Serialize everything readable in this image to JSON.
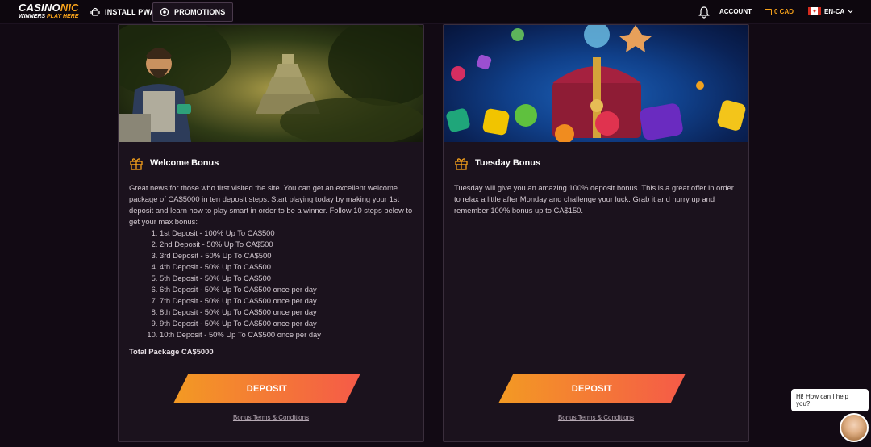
{
  "header": {
    "logo_main": "CASINO",
    "logo_accent": "NIC",
    "logo_tag_1": "WINNERS",
    "logo_tag_2": "PLAY HERE",
    "install_pwa": "INSTALL PWA",
    "promotions": "PROMOTIONS",
    "account": "ACCOUNT",
    "balance": "0 CAD",
    "language": "EN-CA"
  },
  "cards": [
    {
      "title": "Welcome Bonus",
      "intro": "Great news for those who first visited the site. You can get an excellent welcome package of CA$5000 in ten deposit steps. Start playing today by making your 1st deposit and learn how to play smart in order to be a winner. Follow 10 steps below to get your max bonus:",
      "steps": [
        "1st Deposit - 100% Up To CA$500",
        "2nd Deposit - 50% Up To CA$500",
        "3rd Deposit - 50% Up To CA$500",
        "4th Deposit - 50% Up To CA$500",
        "5th Deposit - 50% Up To CA$500",
        "6th Deposit - 50% Up To CA$500 once per day",
        "7th Deposit - 50% Up To CA$500 once per day",
        "8th Deposit - 50% Up To CA$500 once per day",
        "9th Deposit - 50% Up To CA$500 once per day",
        "10th Deposit - 50% Up To CA$500 once per day"
      ],
      "total": "Total Package CA$5000",
      "deposit_label": "DEPOSIT",
      "terms_label": "Bonus Terms & Conditions"
    },
    {
      "title": "Tuesday Bonus",
      "intro": "Tuesday will give you an amazing 100% deposit bonus. This is a great offer in order to relax a little after Monday and challenge your luck. Grab it and hurry up and remember 100% bonus up to CA$150.",
      "deposit_label": "DEPOSIT",
      "terms_label": "Bonus Terms & Conditions"
    }
  ],
  "chat": {
    "message": "Hi! How can I help you?"
  },
  "colors": {
    "accent": "#f7a21b",
    "button_start": "#f39a23",
    "button_end": "#f55a48",
    "card_bg": "#1b121d"
  }
}
